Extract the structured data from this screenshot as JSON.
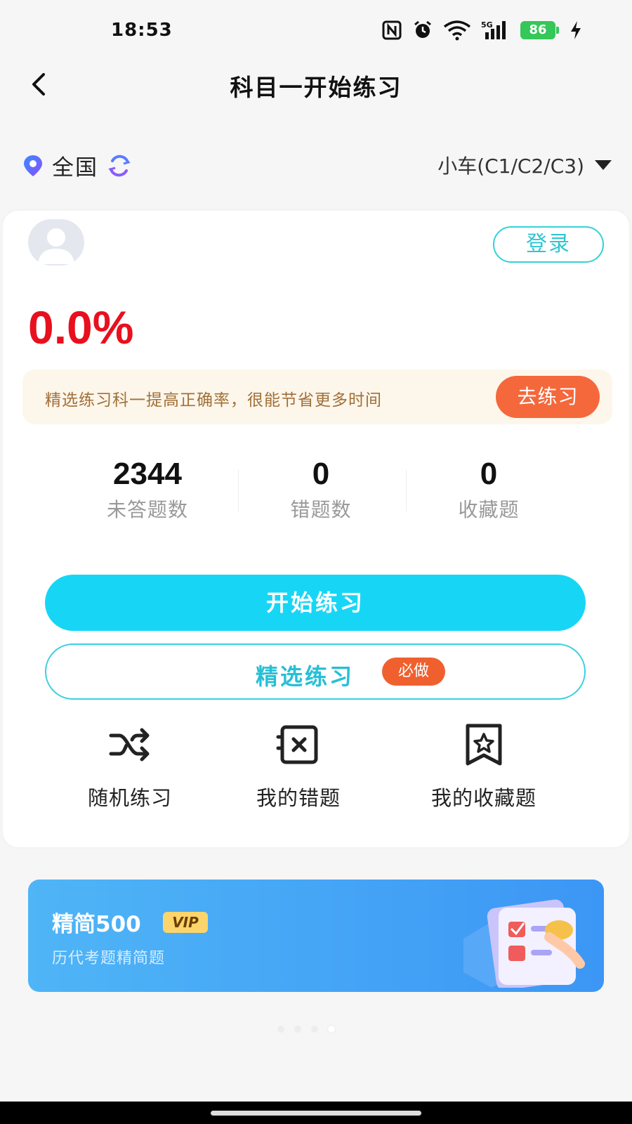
{
  "status_bar": {
    "time": "18:53",
    "battery": "86",
    "network": "5G"
  },
  "header": {
    "title": "科目一开始练习"
  },
  "region": {
    "label": "全国",
    "vehicle": "小车(C1/C2/C3)"
  },
  "card": {
    "login_label": "登录",
    "accuracy": "0.0%",
    "tip": {
      "text": "精选练习科一提高正确率，很能节省更多时间",
      "button": "去练习"
    },
    "stats": [
      {
        "value": "2344",
        "label": "未答题数"
      },
      {
        "value": "0",
        "label": "错题数"
      },
      {
        "value": "0",
        "label": "收藏题"
      }
    ],
    "start_button": "开始练习",
    "selected_button": {
      "label": "精选练习",
      "badge": "必做"
    },
    "tools": [
      {
        "label": "随机练习",
        "icon": "shuffle-icon"
      },
      {
        "label": "我的错题",
        "icon": "wrong-questions-icon"
      },
      {
        "label": "我的收藏题",
        "icon": "bookmark-star-icon"
      }
    ]
  },
  "banner": {
    "title": "精简500",
    "badge": "VIP",
    "subtitle": "历代考题精简题"
  },
  "colors": {
    "accent": "#17d6f5",
    "accuracy": "#e8101e",
    "orange": "#f4683b",
    "vip_blue": "#3c96f5"
  }
}
